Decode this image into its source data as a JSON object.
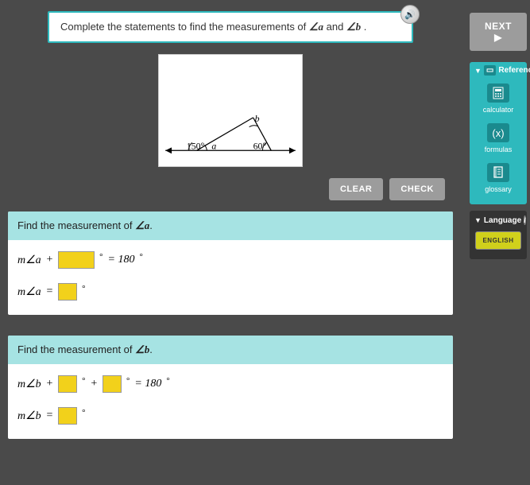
{
  "instruction": {
    "prefix": "Complete the statements to find the measurements of ",
    "var_a": "∠a",
    "mid": " and ",
    "var_b": "∠b",
    "suffix": " ."
  },
  "figure": {
    "angle_left": "150°",
    "label_a": "a",
    "angle_right": "60°",
    "label_b": "b"
  },
  "buttons": {
    "clear": "CLEAR",
    "check": "CHECK",
    "next": "NEXT ▶"
  },
  "section_a": {
    "title_prefix": "Find the measurement of ",
    "title_var": "∠a",
    "title_suffix": ".",
    "eq1": {
      "lhs": "m∠a",
      "plus": "+",
      "rhs": "= 180"
    },
    "eq2": {
      "lhs": "m∠a",
      "eq": "="
    }
  },
  "section_b": {
    "title_prefix": "Find the measurement of ",
    "title_var": "∠b",
    "title_suffix": ".",
    "eq1": {
      "lhs": "m∠b",
      "plus": "+",
      "plus2": "+",
      "rhs": "= 180"
    },
    "eq2": {
      "lhs": "m∠b",
      "eq": "="
    }
  },
  "reference": {
    "header": "Reference",
    "items": [
      {
        "label": "calculator"
      },
      {
        "label": "formulas"
      },
      {
        "label": "glossary"
      }
    ]
  },
  "language": {
    "header": "Language",
    "button": "ENGLISH"
  }
}
